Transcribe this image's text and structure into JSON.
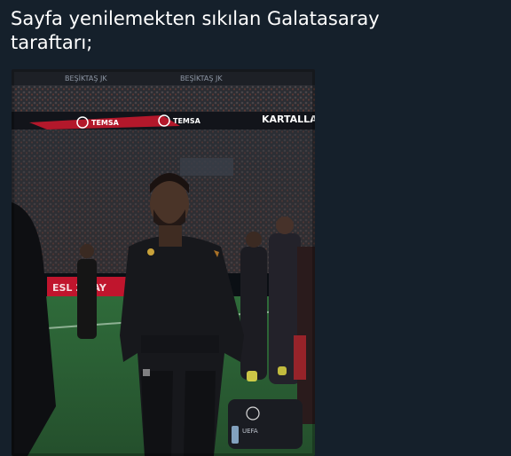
{
  "tweet": {
    "text": "Sayfa yenilemekten sıkılan Galatasaray\ntaraftarı;"
  },
  "media": {
    "stadium_banner_text": "KARTALLAR",
    "sponsor_text": "TEMSA",
    "stand_text": "BEŞİKTAŞ JK",
    "ad_board_text": "ESL 24 AY",
    "badge_text": "UEFA"
  }
}
